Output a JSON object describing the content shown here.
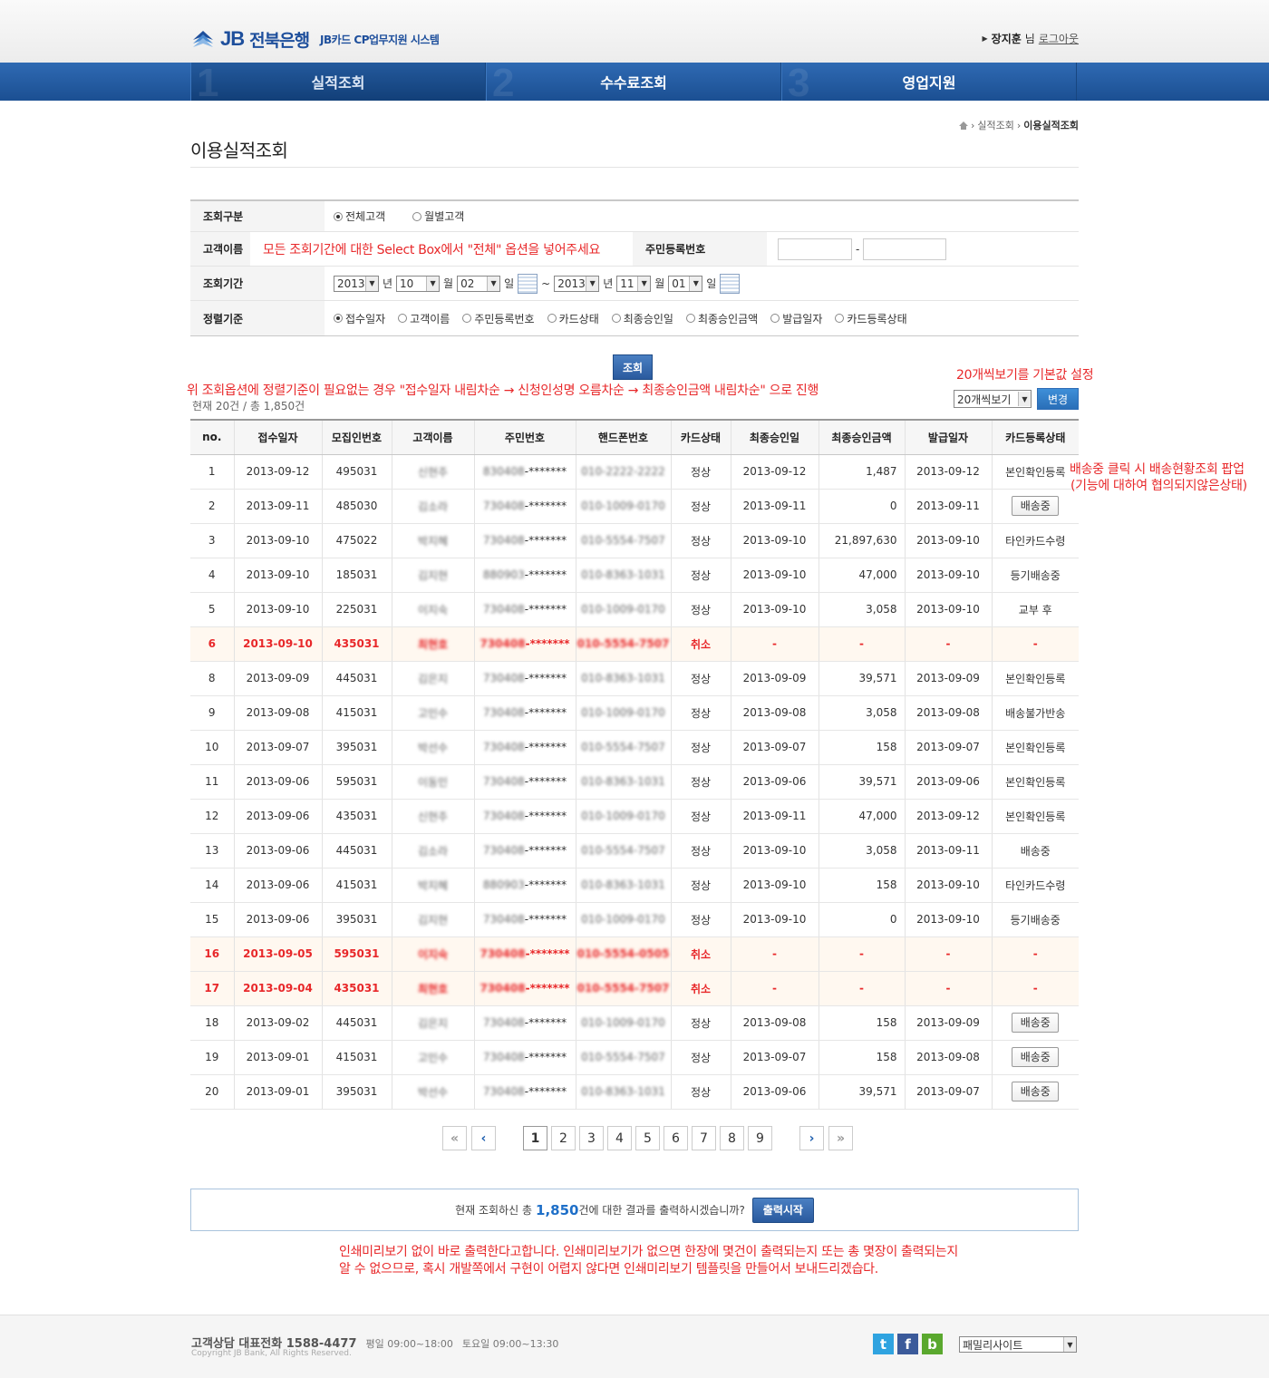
{
  "header": {
    "bank_name": "전북은행",
    "logo_jb": "JB",
    "system_name": "JB카드 CP업무지원 시스템",
    "user_name": "장지훈",
    "user_suffix": "님",
    "logout": "로그아웃"
  },
  "nav": [
    {
      "num": "1",
      "label": "실적조회"
    },
    {
      "num": "2",
      "label": "수수료조회"
    },
    {
      "num": "3",
      "label": "영업지원"
    }
  ],
  "breadcrumb": {
    "parent": "실적조회",
    "current": "이용실적조회"
  },
  "page_title": "이용실적조회",
  "search": {
    "type_label": "조회구분",
    "type_options": [
      "전체고객",
      "월별고객"
    ],
    "name_label": "고객이름",
    "name_note": "모든 조회기간에 대한 Select Box에서 \"전체\" 옵션을 넣어주세요",
    "rrn_label": "주민등록번호",
    "rrn_dash": "-",
    "period_label": "조회기간",
    "from_year": "2013",
    "from_month": "10",
    "from_day": "02",
    "to_year": "2013",
    "to_month": "11",
    "to_day": "01",
    "unit_year": "년",
    "unit_month": "월",
    "unit_day": "일",
    "tilde": "~",
    "sort_label": "정렬기준",
    "sort_options": [
      "접수일자",
      "고객이름",
      "주민등록번호",
      "카드상태",
      "최종승인일",
      "최종승인금액",
      "발급일자",
      "카드등록상태"
    ],
    "search_button": "조회"
  },
  "notes": {
    "page_size": "20개씩보기를 기본값 설정",
    "sort": "위 조회옵션에 정렬기준이 필요없는 경우 \"접수일자 내림차순 → 신청인성명 오름차순 → 최종승인금액 내림차순\" 으로 진행",
    "shipping_1": "배송중 클릭 시 배송현황조회 팝업",
    "shipping_2": "(기능에 대하여 협의되지않은상태)",
    "print_1": "인쇄미리보기 없이 바로 출력한다고합니다. 인쇄미리보기가 없으면 한장에 몇건이 출력되는지 또는 총 몇장이 출력되는지",
    "print_2": "알 수 없으므로, 혹시 개발쪽에서 구현이 어렵지 않다면 인쇄미리보기 템플릿을 만들어서 보내드리겠습다."
  },
  "summary": "현재 20건 / 총 1,850건",
  "page_size_select": "20개씩보기",
  "change_button": "변경",
  "table": {
    "columns": [
      "no.",
      "접수일자",
      "모집인번호",
      "고객이름",
      "주민번호",
      "핸드폰번호",
      "카드상태",
      "최종승인일",
      "최종승인금액",
      "발급일자",
      "카드등록상태"
    ],
    "rows": [
      {
        "no": "1",
        "date": "2013-09-12",
        "agent": "495031",
        "name": "신현주",
        "rrn": "830408-*******",
        "phone": "010-2222-2222",
        "status": "정상",
        "approve": "2013-09-12",
        "amount": "1,487",
        "issue": "2013-09-12",
        "reg": "본인확인등록",
        "btn": false,
        "cancel": false
      },
      {
        "no": "2",
        "date": "2013-09-11",
        "agent": "485030",
        "name": "김소라",
        "rrn": "730408-*******",
        "phone": "010-1009-0170",
        "status": "정상",
        "approve": "2013-09-11",
        "amount": "0",
        "issue": "2013-09-11",
        "reg": "배송중",
        "btn": true,
        "cancel": false
      },
      {
        "no": "3",
        "date": "2013-09-10",
        "agent": "475022",
        "name": "박지혜",
        "rrn": "730408-*******",
        "phone": "010-5554-7507",
        "status": "정상",
        "approve": "2013-09-10",
        "amount": "21,897,630",
        "issue": "2013-09-10",
        "reg": "타인카드수령",
        "btn": false,
        "cancel": false
      },
      {
        "no": "4",
        "date": "2013-09-10",
        "agent": "185031",
        "name": "김지현",
        "rrn": "880903-*******",
        "phone": "010-8363-1031",
        "status": "정상",
        "approve": "2013-09-10",
        "amount": "47,000",
        "issue": "2013-09-10",
        "reg": "등기배송중",
        "btn": false,
        "cancel": false
      },
      {
        "no": "5",
        "date": "2013-09-10",
        "agent": "225031",
        "name": "이지숙",
        "rrn": "730408-*******",
        "phone": "010-1009-0170",
        "status": "정상",
        "approve": "2013-09-10",
        "amount": "3,058",
        "issue": "2013-09-10",
        "reg": "교부 후",
        "btn": false,
        "cancel": false
      },
      {
        "no": "6",
        "date": "2013-09-10",
        "agent": "435031",
        "name": "최현호",
        "rrn": "730408-*******",
        "phone": "010-5554-7507",
        "status": "취소",
        "approve": "-",
        "amount": "-",
        "issue": "-",
        "reg": "-",
        "btn": false,
        "cancel": true
      },
      {
        "no": "8",
        "date": "2013-09-09",
        "agent": "445031",
        "name": "김은지",
        "rrn": "730408-*******",
        "phone": "010-8363-1031",
        "status": "정상",
        "approve": "2013-09-09",
        "amount": "39,571",
        "issue": "2013-09-09",
        "reg": "본인확인등록",
        "btn": false,
        "cancel": false
      },
      {
        "no": "9",
        "date": "2013-09-08",
        "agent": "415031",
        "name": "고민수",
        "rrn": "730408-*******",
        "phone": "010-1009-0170",
        "status": "정상",
        "approve": "2013-09-08",
        "amount": "3,058",
        "issue": "2013-09-08",
        "reg": "배송불가반송",
        "btn": false,
        "cancel": false
      },
      {
        "no": "10",
        "date": "2013-09-07",
        "agent": "395031",
        "name": "박선수",
        "rrn": "730408-*******",
        "phone": "010-5554-7507",
        "status": "정상",
        "approve": "2013-09-07",
        "amount": "158",
        "issue": "2013-09-07",
        "reg": "본인확인등록",
        "btn": false,
        "cancel": false
      },
      {
        "no": "11",
        "date": "2013-09-06",
        "agent": "595031",
        "name": "이동민",
        "rrn": "730408-*******",
        "phone": "010-8363-1031",
        "status": "정상",
        "approve": "2013-09-06",
        "amount": "39,571",
        "issue": "2013-09-06",
        "reg": "본인확인등록",
        "btn": false,
        "cancel": false
      },
      {
        "no": "12",
        "date": "2013-09-06",
        "agent": "435031",
        "name": "신현주",
        "rrn": "730408-*******",
        "phone": "010-1009-0170",
        "status": "정상",
        "approve": "2013-09-11",
        "amount": "47,000",
        "issue": "2013-09-12",
        "reg": "본인확인등록",
        "btn": false,
        "cancel": false
      },
      {
        "no": "13",
        "date": "2013-09-06",
        "agent": "445031",
        "name": "김소라",
        "rrn": "730408-*******",
        "phone": "010-5554-7507",
        "status": "정상",
        "approve": "2013-09-10",
        "amount": "3,058",
        "issue": "2013-09-11",
        "reg": "배송중",
        "btn": false,
        "cancel": false
      },
      {
        "no": "14",
        "date": "2013-09-06",
        "agent": "415031",
        "name": "박지혜",
        "rrn": "880903-*******",
        "phone": "010-8363-1031",
        "status": "정상",
        "approve": "2013-09-10",
        "amount": "158",
        "issue": "2013-09-10",
        "reg": "타인카드수령",
        "btn": false,
        "cancel": false
      },
      {
        "no": "15",
        "date": "2013-09-06",
        "agent": "395031",
        "name": "김지현",
        "rrn": "730408-*******",
        "phone": "010-1009-0170",
        "status": "정상",
        "approve": "2013-09-10",
        "amount": "0",
        "issue": "2013-09-10",
        "reg": "등기배송중",
        "btn": false,
        "cancel": false
      },
      {
        "no": "16",
        "date": "2013-09-05",
        "agent": "595031",
        "name": "이지숙",
        "rrn": "730408-*******",
        "phone": "010-5554-0505",
        "status": "취소",
        "approve": "-",
        "amount": "-",
        "issue": "-",
        "reg": "-",
        "btn": false,
        "cancel": true
      },
      {
        "no": "17",
        "date": "2013-09-04",
        "agent": "435031",
        "name": "최현호",
        "rrn": "730408-*******",
        "phone": "010-5554-7507",
        "status": "취소",
        "approve": "-",
        "amount": "-",
        "issue": "-",
        "reg": "-",
        "btn": false,
        "cancel": true
      },
      {
        "no": "18",
        "date": "2013-09-02",
        "agent": "445031",
        "name": "김은지",
        "rrn": "730408-*******",
        "phone": "010-1009-0170",
        "status": "정상",
        "approve": "2013-09-08",
        "amount": "158",
        "issue": "2013-09-09",
        "reg": "배송중",
        "btn": true,
        "cancel": false
      },
      {
        "no": "19",
        "date": "2013-09-01",
        "agent": "415031",
        "name": "고민수",
        "rrn": "730408-*******",
        "phone": "010-5554-7507",
        "status": "정상",
        "approve": "2013-09-07",
        "amount": "158",
        "issue": "2013-09-08",
        "reg": "배송중",
        "btn": true,
        "cancel": false
      },
      {
        "no": "20",
        "date": "2013-09-01",
        "agent": "395031",
        "name": "박선수",
        "rrn": "730408-*******",
        "phone": "010-8363-1031",
        "status": "정상",
        "approve": "2013-09-06",
        "amount": "39,571",
        "issue": "2013-09-07",
        "reg": "배송중",
        "btn": true,
        "cancel": false
      }
    ]
  },
  "pagination": {
    "first": "«",
    "prev": "‹",
    "pages": [
      "1",
      "2",
      "3",
      "4",
      "5",
      "6",
      "7",
      "8",
      "9"
    ],
    "current": "1",
    "next": "›",
    "last": "»"
  },
  "print": {
    "prefix": "현재 조회하신 총",
    "count": "1,850",
    "suffix": "건에 대한 결과를 출력하시겠습니까?",
    "button": "출력시작"
  },
  "footer": {
    "phone_label": "고객상담 대표전화 1588-4477",
    "weekday": "평일 09:00~18:00",
    "saturday": "토요일 09:00~13:30",
    "copyright": "Copyright JB Bank, All Rights Reserved.",
    "family_site": "패밀리사이트",
    "sns": [
      "t",
      "f",
      "b"
    ]
  },
  "colors": {
    "brand": "#1e4f9c",
    "nav": "#245fa8",
    "note": "#e8282a",
    "accent": "#1e6fc8"
  }
}
